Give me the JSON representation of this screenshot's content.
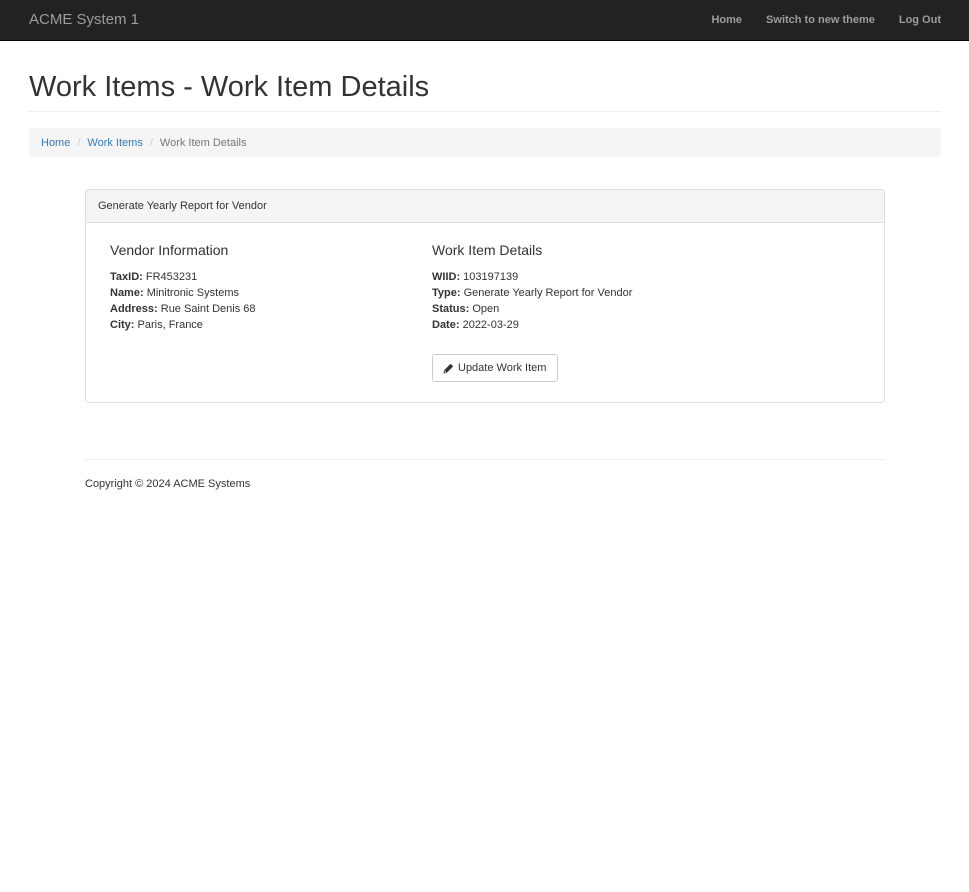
{
  "navbar": {
    "brand": "ACME System 1",
    "links": [
      "Home",
      "Switch to new theme",
      "Log Out"
    ]
  },
  "page": {
    "title": "Work Items - Work Item Details"
  },
  "breadcrumb": {
    "items": [
      "Home",
      "Work Items"
    ],
    "separator": "/",
    "active": "Work Item Details"
  },
  "panel": {
    "heading": "Generate Yearly Report for Vendor",
    "vendor": {
      "title": "Vendor Information",
      "fields": [
        {
          "label": "TaxID:",
          "value": "FR453231"
        },
        {
          "label": "Name:",
          "value": "Minitronic Systems"
        },
        {
          "label": "Address:",
          "value": "Rue Saint Denis 68"
        },
        {
          "label": "City:",
          "value": "Paris, France"
        }
      ]
    },
    "details": {
      "title": "Work Item Details",
      "fields": [
        {
          "label": "WIID:",
          "value": "103197139"
        },
        {
          "label": "Type:",
          "value": "Generate Yearly Report for Vendor"
        },
        {
          "label": "Status:",
          "value": "Open"
        },
        {
          "label": "Date:",
          "value": "2022-03-29"
        }
      ]
    },
    "update_button": {
      "label": "Update Work Item",
      "icon": "pencil-icon"
    }
  },
  "footer": {
    "copyright": "Copyright © 2024 ACME Systems"
  },
  "colors": {
    "navbar_bg": "#222222",
    "link": "#337ab7",
    "breadcrumb_bg": "#f5f5f5"
  }
}
